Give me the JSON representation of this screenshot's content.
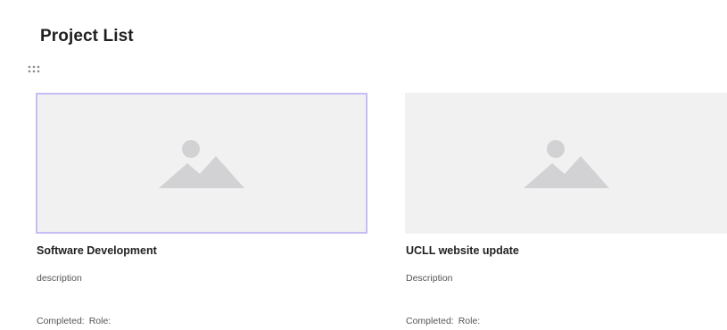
{
  "page": {
    "title": "Project List"
  },
  "projects": [
    {
      "title": "Software Development",
      "description": "description",
      "completed_label": "Completed:",
      "role_label": "Role:",
      "image_icon": "image-placeholder-icon",
      "selected": true
    },
    {
      "title": "UCLL website update",
      "description": "Description",
      "completed_label": "Completed:",
      "role_label": "Role:",
      "image_icon": "image-placeholder-icon",
      "selected": false
    }
  ],
  "icons": {
    "drag_handle": "drag-handle-icon"
  },
  "colors": {
    "selected_border": "#c6bdf5",
    "placeholder_bg": "#f1f1f2",
    "placeholder_icon": "#d2d2d4"
  }
}
